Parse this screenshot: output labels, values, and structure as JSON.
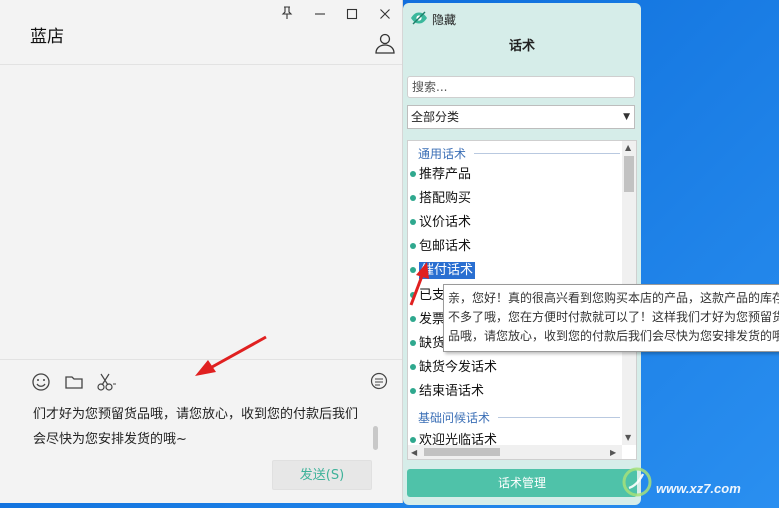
{
  "chat": {
    "title": "蓝店",
    "input_text": "们才好为您预留货品哦，请您放心，收到您的付款后我们会尽快为您安排发货的哦~",
    "send_label": "发送(S)"
  },
  "panel": {
    "hide_label": "隐藏",
    "title": "话术",
    "search_placeholder": "搜索...",
    "category_value": "全部分类",
    "groups": [
      {
        "name": "通用话术"
      },
      {
        "name": "基础问候话术"
      }
    ],
    "items": [
      {
        "label": "推荐产品"
      },
      {
        "label": "搭配购买"
      },
      {
        "label": "议价话术"
      },
      {
        "label": "包邮话术"
      },
      {
        "label": "催付话术"
      },
      {
        "label": "已支"
      },
      {
        "label": "发票"
      },
      {
        "label": "缺货"
      },
      {
        "label": "缺货今发话术"
      },
      {
        "label": "结束语话术"
      },
      {
        "label": "欢迎光临话术"
      }
    ],
    "manage_label": "话术管理"
  },
  "tooltip": {
    "text": "亲，您好！真的很高兴看到您购买本店的产品，这款产品的库存不多了哦，您在方便时付款就可以了！这样我们才好为您预留货品哦，请您放心，收到您的付款后我们会尽快为您安排发货的哦~"
  },
  "watermark": {
    "text": "www.xz7.com"
  },
  "colors": {
    "accent": "#4fc2a9",
    "panel_bg": "#d6ede9",
    "selection": "#2a6fd1",
    "arrow": "#e02020",
    "desktop": "#1476e0"
  }
}
